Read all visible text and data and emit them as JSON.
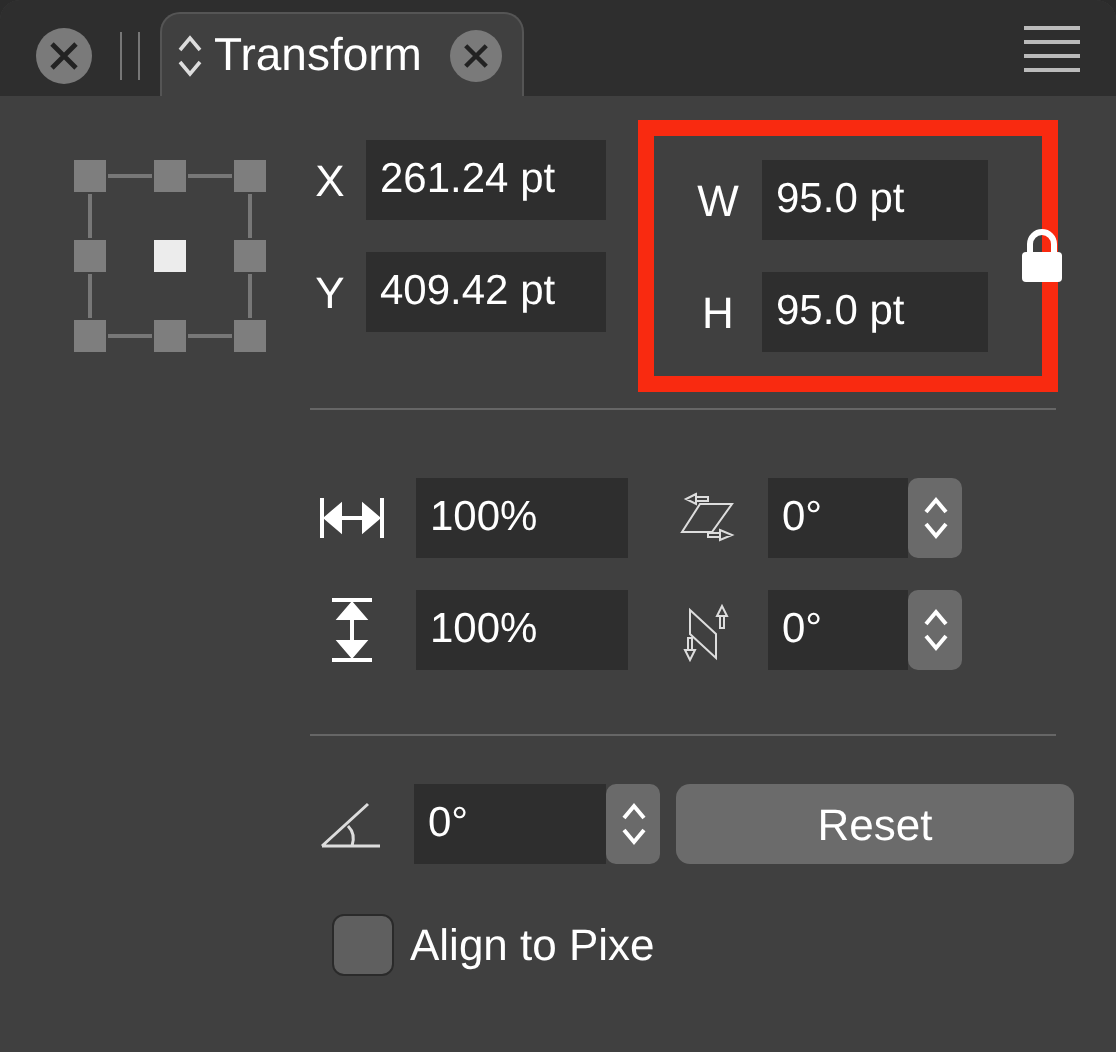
{
  "tabs": [
    {
      "label": "Transform",
      "selected": true
    }
  ],
  "anchor_points": [
    {
      "selected": false
    },
    {
      "selected": false
    },
    {
      "selected": false
    },
    {
      "selected": false
    },
    {
      "selected": true
    },
    {
      "selected": false
    },
    {
      "selected": false
    },
    {
      "selected": false
    },
    {
      "selected": false
    }
  ],
  "position": [
    {
      "label": "X",
      "value": "261.24 pt"
    },
    {
      "label": "Y",
      "value": "409.42 pt"
    }
  ],
  "size": {
    "highlighted": true,
    "locked": true,
    "fields": [
      {
        "label": "W",
        "value": "95.0 pt"
      },
      {
        "label": "H",
        "value": "95.0 pt"
      }
    ]
  },
  "scale": [
    {
      "kind": "width",
      "value": "100%"
    },
    {
      "kind": "height",
      "value": "100%"
    }
  ],
  "shear": [
    {
      "kind": "horizontal",
      "value": "0°"
    },
    {
      "kind": "vertical",
      "value": "0°"
    }
  ],
  "rotation": {
    "value": "0°"
  },
  "reset_button": "Reset",
  "align_to_pixel": {
    "label": "Align to Pixe",
    "checked": false
  }
}
